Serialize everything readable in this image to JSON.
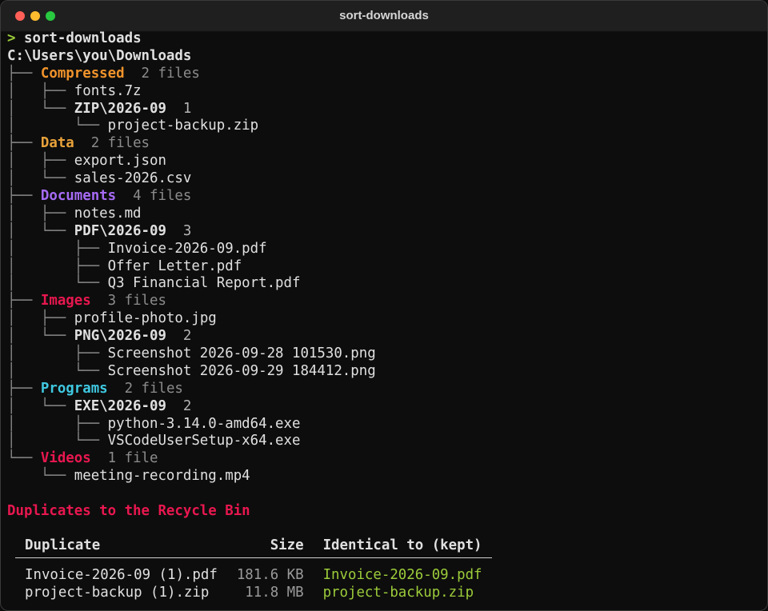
{
  "window": {
    "title": "sort-downloads"
  },
  "colors": {
    "compressed": "#f0932b",
    "data": "#e8a23a",
    "documents": "#a66bf5",
    "images": "#e8174f",
    "programs": "#3fc8e0",
    "videos": "#e8174f",
    "prompt": "#9ccc3a",
    "duplicates_title": "#e8174f",
    "kept_file": "#9ccc3a"
  },
  "prompt": {
    "symbol": ">",
    "command": "sort-downloads"
  },
  "root_path": "C:\\Users\\you\\Downloads",
  "categories": [
    {
      "name": "Compressed",
      "count": "2 files",
      "items": [
        {
          "type": "file",
          "name": "fonts.7z"
        },
        {
          "type": "folder",
          "name": "ZIP\\2026-09",
          "count": "1",
          "files": [
            "project-backup.zip"
          ]
        }
      ]
    },
    {
      "name": "Data",
      "count": "2 files",
      "items": [
        {
          "type": "file",
          "name": "export.json"
        },
        {
          "type": "file",
          "name": "sales-2026.csv"
        }
      ]
    },
    {
      "name": "Documents",
      "count": "4 files",
      "items": [
        {
          "type": "file",
          "name": "notes.md"
        },
        {
          "type": "folder",
          "name": "PDF\\2026-09",
          "count": "3",
          "files": [
            "Invoice-2026-09.pdf",
            "Offer Letter.pdf",
            "Q3 Financial Report.pdf"
          ]
        }
      ]
    },
    {
      "name": "Images",
      "count": "3 files",
      "items": [
        {
          "type": "file",
          "name": "profile-photo.jpg"
        },
        {
          "type": "folder",
          "name": "PNG\\2026-09",
          "count": "2",
          "files": [
            "Screenshot 2026-09-28 101530.png",
            "Screenshot 2026-09-29 184412.png"
          ]
        }
      ]
    },
    {
      "name": "Programs",
      "count": "2 files",
      "items": [
        {
          "type": "folder",
          "name": "EXE\\2026-09",
          "count": "2",
          "files": [
            "python-3.14.0-amd64.exe",
            "VSCodeUserSetup-x64.exe"
          ]
        }
      ]
    },
    {
      "name": "Videos",
      "count": "1 file",
      "items": [
        {
          "type": "file",
          "name": "meeting-recording.mp4"
        }
      ]
    }
  ],
  "duplicates": {
    "title": "Duplicates to the Recycle Bin",
    "headers": {
      "duplicate": "Duplicate",
      "size": "Size",
      "kept": "Identical to (kept)"
    },
    "rows": [
      {
        "duplicate": "Invoice-2026-09 (1).pdf",
        "size": "181.6 KB",
        "kept": "Invoice-2026-09.pdf"
      },
      {
        "duplicate": "project-backup (1).zip",
        "size": "11.8 MB",
        "kept": "project-backup.zip"
      }
    ]
  }
}
